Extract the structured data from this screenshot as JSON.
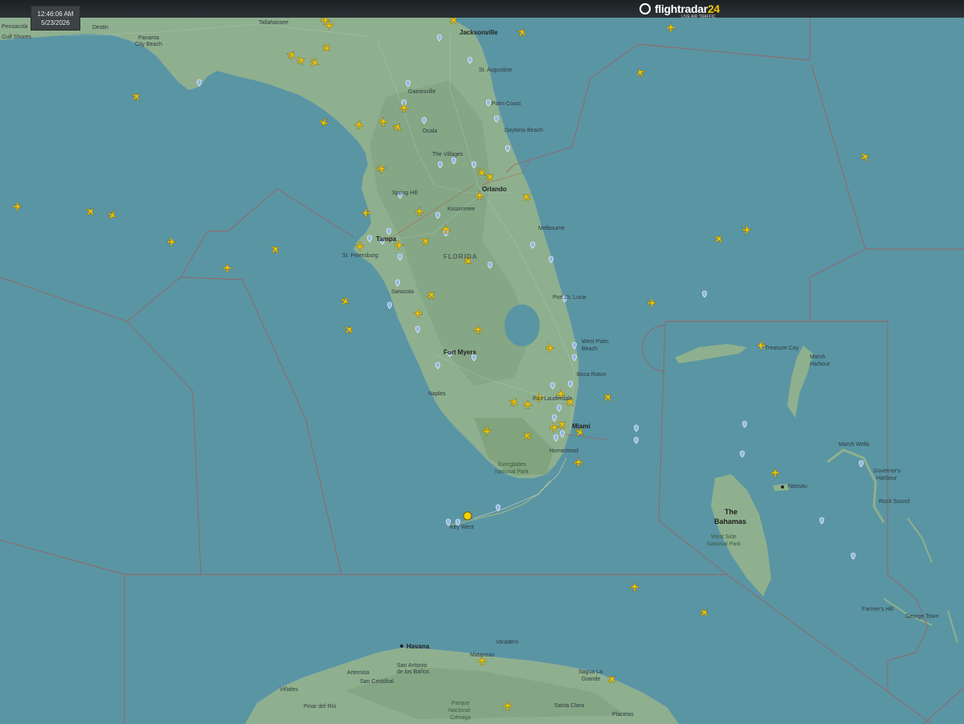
{
  "header": {
    "time": "12:46:06 AM",
    "date": "5/23/2026",
    "brand_name": "flightradar",
    "brand_number": "24",
    "brand_tagline": "LIVE AIR TRAFFIC"
  },
  "map": {
    "region_label": "FLORIDA",
    "country_label_line1": "The",
    "country_label_line2": "Bahamas",
    "places": {
      "pensacola": "Pensacola",
      "gulf_shores": "Gulf Shores",
      "destin": "Destin",
      "panama_city_1": "Panama",
      "panama_city_2": "City Beach",
      "tallahassee": "Tallahassee",
      "jacksonville": "Jacksonville",
      "st_augustine": "St. Augustine",
      "gainesville": "Gainesville",
      "palm_coast": "Palm Coast",
      "ocala": "Ocala",
      "daytona": "Daytona Beach",
      "villages": "The Villages",
      "orlando": "Orlando",
      "spring_hill": "Spring Hill",
      "kissimmee": "Kissimmee",
      "melbourne": "Melbourne",
      "tampa": "Tampa",
      "st_petersburg": "St. Petersburg",
      "sarasota": "Sarasota",
      "port_st_lucie": "Port St. Lucie",
      "wpb_1": "West Palm",
      "wpb_2": "Beach",
      "fort_myers": "Fort Myers",
      "boca_raton": "Boca Raton",
      "fort_lauderdale": "Fort Lauderdale",
      "naples": "Naples",
      "miami": "Miami",
      "homestead": "Homestead",
      "everglades_1": "Everglades",
      "everglades_2": "National Park",
      "key_west": "Key West",
      "treasure_cay": "Treasure Cay",
      "marsh_harbour_1": "Marsh",
      "marsh_harbour_2": "Harbour",
      "nassau": "Nassau",
      "governors_1": "Governor's",
      "governors_2": "Harbour",
      "rock_sound": "Rock Sound",
      "marsh_wells": "Marsh Wells",
      "west_side_1": "West Side",
      "west_side_2": "National Park",
      "farmers_hill": "Farmer's Hill",
      "george_town": "George Town",
      "havana": "Havana",
      "varadero": "Varadero",
      "matanzas": "Matanzas",
      "artemisa": "Artemisa",
      "san_antonio_1": "San Antonio",
      "san_antonio_2": "de los Baños",
      "san_cristobal": "San Cristóbal",
      "vinales": "Viñales",
      "pinar": "Pinar del Río",
      "sagua_1": "Sagua La",
      "sagua_2": "Grande",
      "santa_clara": "Santa Clara",
      "placetas": "Placetas",
      "cienaga_1": "Parque",
      "cienaga_2": "Nacional",
      "cienaga_3": "Ciénaga"
    }
  },
  "colors": {
    "water": "#5a95a3",
    "land": "#8fb08e",
    "land_dark": "#7ea07d",
    "aircraft": "#f2c300",
    "airspace_border": "#a25a5a",
    "airport_marker": "#8fb8e6"
  }
}
